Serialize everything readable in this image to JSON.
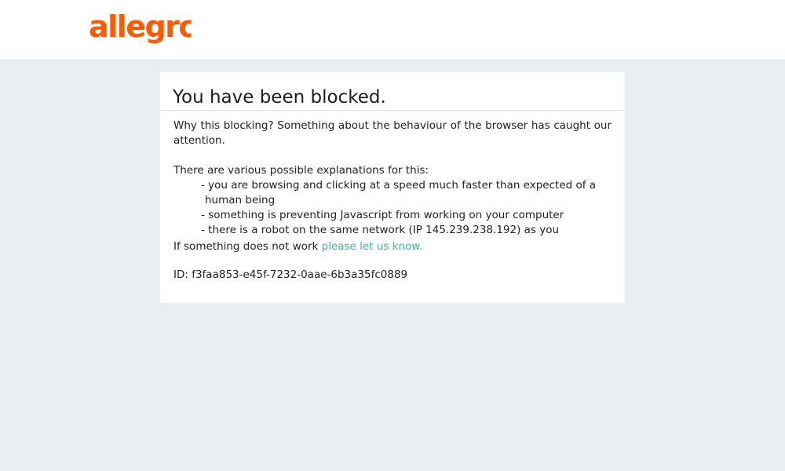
{
  "header": {
    "logo_text": "allegro",
    "brand_color": "#ff5a00"
  },
  "block_card": {
    "title": "You have been blocked.",
    "why_text": "Why this blocking? Something about the behaviour of the browser has caught our attention.",
    "explanations_intro": "There are various possible explanations for this:",
    "reasons": [
      {
        "line1": "- you are browsing and clicking at a speed much faster than expected of a",
        "line2": "human being"
      },
      {
        "line1": "- something is preventing Javascript from working on your computer",
        "line2": ""
      },
      {
        "line1": "- there is a robot on the same network (IP 145.239.238.192) as you",
        "line2": ""
      }
    ],
    "contact_prefix": "If something does not work",
    "contact_link": "please let us know.",
    "request_id": "ID: f3faa853-e45f-7232-0aae-6b3a35fc0889"
  },
  "colors": {
    "background": "#eaeef1",
    "link": "#35b5a3"
  }
}
